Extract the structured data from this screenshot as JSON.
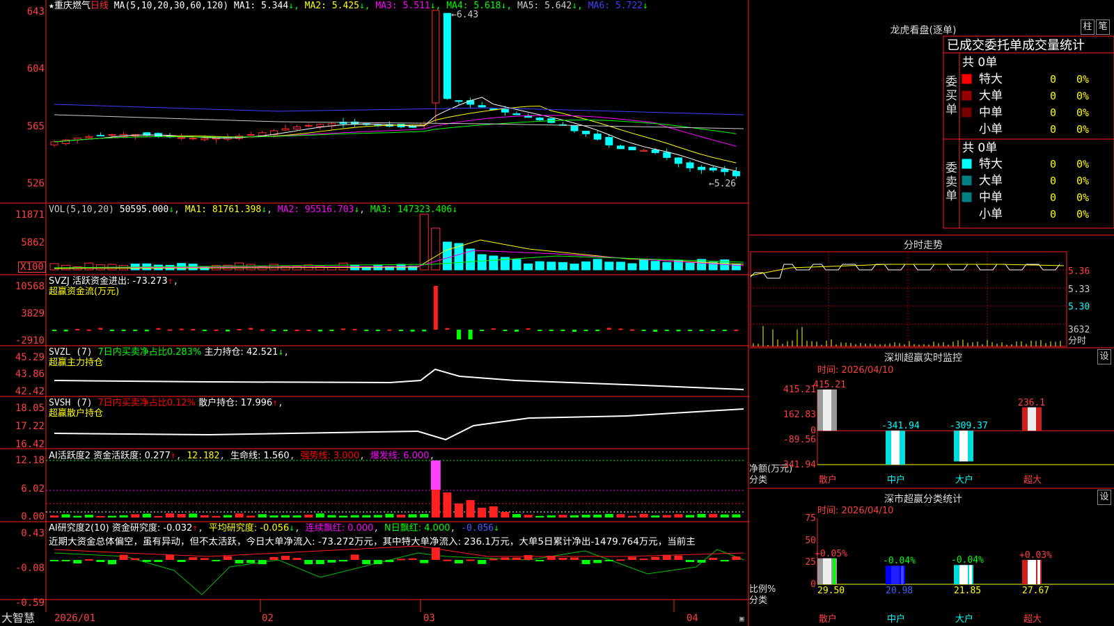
{
  "stock": {
    "star": "★",
    "name": "重庆燃气",
    "period": "日线"
  },
  "main": {
    "ma_header": "MA(5,10,20,30,60,120)",
    "ma": [
      {
        "label": "MA1:",
        "value": "5.344",
        "arrow": "↓",
        "color": "#ffffff"
      },
      {
        "label": "MA2:",
        "value": "5.425",
        "arrow": "↓",
        "color": "#ffff00"
      },
      {
        "label": "MA3:",
        "value": "5.511",
        "arrow": "↓",
        "color": "#ff00ff"
      },
      {
        "label": "MA4:",
        "value": "5.618",
        "arrow": "↓",
        "color": "#00ff00"
      },
      {
        "label": "MA5:",
        "value": "5.642",
        "arrow": "↓",
        "color": "#cccccc"
      },
      {
        "label": "MA6:",
        "value": "5.722",
        "arrow": "↓",
        "color": "#4040ff"
      }
    ],
    "y_ticks": [
      "643",
      "604",
      "565",
      "526"
    ],
    "high_label": "6.43",
    "low_label": "←5.26"
  },
  "vol": {
    "header": "VOL(5,10,20)",
    "value": "50595.000",
    "arrow": "↓",
    "ma1": "MA1: 81761.398",
    "ma1a": "↓",
    "ma2": "MA2: 95516.703",
    "ma2a": "↓",
    "ma3": "MA3: 147323.406",
    "ma3a": "↓",
    "y_ticks": [
      "11871",
      "5862"
    ],
    "unit": "X100"
  },
  "svzj": {
    "header": "SVZJ  活跃资金进出: -73.273",
    "arrow": "↑",
    "sub": "超赢资金流(万元)",
    "y_ticks": [
      "10568",
      "3829",
      "-2910"
    ]
  },
  "svzl": {
    "header": "SVZL (7) ",
    "pct": "7日内买卖净占比0.283%",
    "hold": " 主力持仓: 42.521",
    "arrow": "↓",
    "sub": "超赢主力持仓",
    "y_ticks": [
      "45.29",
      "43.86",
      "42.42"
    ]
  },
  "svsh": {
    "header": "SVSH (7) ",
    "pct": "7日内买卖净占比0.12%",
    "hold": " 散户持仓: 17.996",
    "arrow": "↑",
    "sub": "超赢散户持仓",
    "y_ticks": [
      "18.05",
      "17.22",
      "16.42"
    ]
  },
  "ai1": {
    "header": "AI活跃度2 资金活跃度: 0.277",
    "a1": "↑",
    "v2": "12.182",
    "l3": "生命线: 1.560",
    "l4": "强势线: 3.000",
    "l5": "爆发线: 6.000",
    "y_ticks": [
      "12.18",
      "6.02",
      "0.00"
    ]
  },
  "ai2": {
    "header": "AI研究度2(10) 资金研究度: -0.032",
    "a1": "↑",
    "l2": "平均研究度: -0.056",
    "a2": "↓",
    "l3": "连续飘红: 0.000",
    "l4": "N日飘红: 4.000",
    "l5": "-0.056",
    "a5": "↓",
    "note": "近期大资金总体偏空，虽有异动，但不太活跃，今日大单净流入: -73.272万元，其中特大单净流入: 236.1万元，大单5日累计净出-1479.764万元，当前主",
    "y_ticks": [
      "0.43",
      "-0.08",
      "-0.59"
    ]
  },
  "xaxis": {
    "brand": "大智慧",
    "dates": [
      "2026/01",
      "02",
      "03",
      "04"
    ]
  },
  "dragon": {
    "title": "龙虎看盘(逐单)",
    "btn1": "柱",
    "btn2": "笔",
    "tabs": "已成交委托单成交量统计",
    "buy": {
      "label": "委买单",
      "total": "共 0单",
      "rows": [
        {
          "name": "特大",
          "v": "0",
          "p": "0%",
          "color": "#ff0000"
        },
        {
          "name": "大单",
          "v": "0",
          "p": "0%",
          "color": "#990000"
        },
        {
          "name": "中单",
          "v": "0",
          "p": "0%",
          "color": "#770000"
        },
        {
          "name": "小单",
          "v": "0",
          "p": "0%",
          "color": "#000000"
        }
      ]
    },
    "sell": {
      "label": "委卖单",
      "total": "共 0单",
      "rows": [
        {
          "name": "特大",
          "v": "0",
          "p": "0%",
          "color": "#00ffff"
        },
        {
          "name": "大单",
          "v": "0",
          "p": "0%",
          "color": "#008080"
        },
        {
          "name": "中单",
          "v": "0",
          "p": "0%",
          "color": "#008080"
        },
        {
          "name": "小单",
          "v": "0",
          "p": "0%",
          "color": "#000000"
        }
      ]
    }
  },
  "intraday": {
    "title": "分时走势",
    "prices": [
      "5.36",
      "5.33",
      "5.30"
    ],
    "vol": "3632",
    "unit": "分时"
  },
  "sz_monitor": {
    "title": "深圳超赢实时监控",
    "btn": "设",
    "time": "时间: 2026/04/10",
    "y_ticks": [
      "415.21",
      "162.83",
      "0",
      "-89.56",
      "-341.94"
    ],
    "ylabel": "净额(万元)",
    "xlabel": "分类",
    "bars": [
      {
        "name": "散户",
        "value": 415.21,
        "label": "415.21"
      },
      {
        "name": "中户",
        "value": -341.94,
        "label": "-341.94"
      },
      {
        "name": "大户",
        "value": -309.37,
        "label": "-309.37"
      },
      {
        "name": "超大",
        "value": 236.1,
        "label": "236.1"
      }
    ]
  },
  "sz_class": {
    "title": "深市超赢分类统计",
    "btn": "设",
    "time": "时间: 2026/04/10",
    "y_ticks": [
      "75",
      "50",
      "25",
      "0"
    ],
    "ylabel": "比例%",
    "xlabel": "分类",
    "bars": [
      {
        "name": "散户",
        "value": 29.5,
        "change": "+0.05%"
      },
      {
        "name": "中户",
        "value": 20.98,
        "change": "-0.04%"
      },
      {
        "name": "大户",
        "value": 21.85,
        "change": "-0.04%"
      },
      {
        "name": "超大",
        "value": 27.67,
        "change": "+0.03%"
      }
    ]
  },
  "chart_data": [
    {
      "type": "bar",
      "title": "深圳超赢实时监控",
      "categories": [
        "散户",
        "中户",
        "大户",
        "超大"
      ],
      "values": [
        415.21,
        -341.94,
        -309.37,
        236.1
      ],
      "ylabel": "净额(万元)",
      "xlabel": "分类",
      "ylim": [
        -341.94,
        415.21
      ]
    },
    {
      "type": "bar",
      "title": "深市超赢分类统计",
      "categories": [
        "散户",
        "中户",
        "大户",
        "超大"
      ],
      "values": [
        29.5,
        20.98,
        21.85,
        27.67
      ],
      "ylabel": "比例%",
      "xlabel": "分类",
      "ylim": [
        0,
        75
      ]
    }
  ]
}
